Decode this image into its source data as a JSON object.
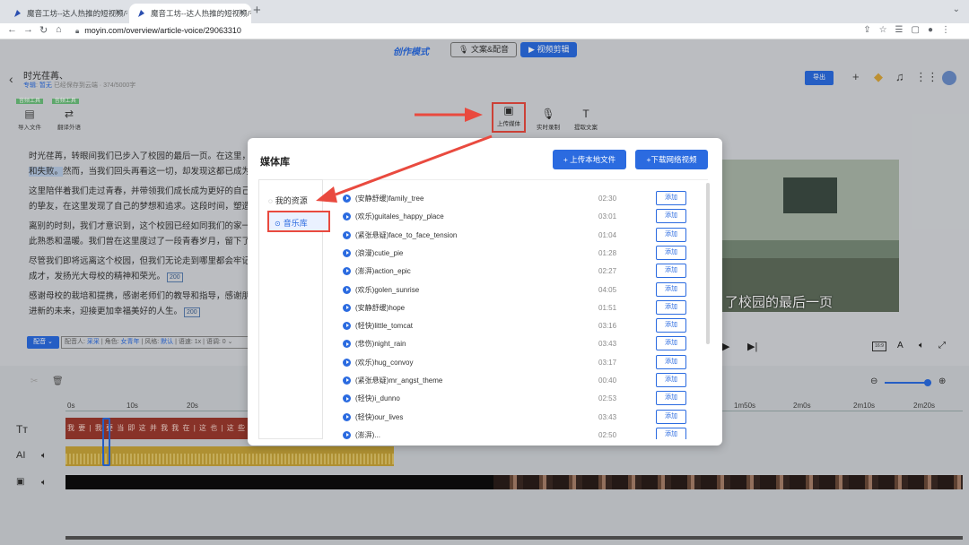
{
  "browser": {
    "tabs": [
      {
        "title": "魔音工坊--达人热推的短视频/有"
      },
      {
        "title": "魔音工坊--达人热推的短视频/有"
      }
    ],
    "url": "moyin.com/overview/article-voice/29063310"
  },
  "app": {
    "mode_label": "创作模式",
    "mode_tabs": [
      {
        "label": "文案&配音"
      },
      {
        "label": "视频剪辑"
      }
    ],
    "doc_title": "时光荏苒、",
    "doc_meta_prefix": "专辑",
    "doc_meta_link": "暂无",
    "doc_meta_rest": "已经保存到云端 · 374/5000字",
    "export_label": "导出"
  },
  "editor": {
    "rule_tags": [
      "音频工具",
      "音频工具"
    ],
    "tools": [
      {
        "label": "导入文件"
      },
      {
        "label": "翻译外语"
      }
    ],
    "right_tools": [
      {
        "label": "上传媒体"
      },
      {
        "label": "实时录制"
      },
      {
        "label": "提取文案"
      }
    ],
    "paragraphs": [
      {
        "line1": "时光荏苒，转眼间我们已步入了校园的最后一页。在这里，我",
        "line2_hl": "和失败。",
        "line2": "然而，当我们回头再看这一切，却发现这都已成为人"
      },
      {
        "line1": "这里陪伴着我们走过青春，并带领我们成长成为更好的自己。",
        "line2": "的挚友，在这里发现了自己的梦想和追求。这段时间，塑造了"
      },
      {
        "line1": "离别的时刻，我们才意识到，这个校园已经如同我们的家一样",
        "line2": "此熟悉和温暖。我们曾在这里度过了一段青春岁月，留下了点"
      },
      {
        "line1": "尽管我们即将远离这个校园，但我们无论走到哪里都会牢记这",
        "line2": "成才，发扬光大母校的精神和荣光。",
        "count": "200"
      },
      {
        "line1": "感谢母校的栽培和提携，感谢老师们的教导和指导，感谢朋友",
        "line2": "进新的未来，迎接更加幸福美好的人生。",
        "count": "200"
      }
    ],
    "voice_btn": "配音",
    "voice_meta_1": "配音人:",
    "voice_meta_link1": "采采",
    "voice_meta_2": "| 角色:",
    "voice_meta_link2": "女青年",
    "voice_meta_3": "| 风格:",
    "voice_meta_link3": "默认",
    "voice_meta_4": "| 语速: 1x | 语调: 0"
  },
  "preview": {
    "subtitle": "了校园的最后一页",
    "ratio": "16:9"
  },
  "timeline": {
    "ruler": [
      "0s",
      "10s",
      "20s",
      "1m50s",
      "2m0s",
      "2m10s",
      "2m20s"
    ],
    "text_clip": "我 要 | 我 要 当 即 这 并 我 我 在 | 这 也 | 这 些 这 天",
    "track_icons": [
      "text-track-icon",
      "ai-voice-track-icon",
      "video-track-icon"
    ]
  },
  "modal": {
    "title": "媒体库",
    "upload_local": "+ 上传本地文件",
    "download_online": "+下载网络视频",
    "side": [
      {
        "label": "我的资源"
      },
      {
        "label": "音乐库"
      }
    ],
    "add_label": "添加",
    "tracks": [
      {
        "name": "(安静舒缓)family_tree",
        "duration": "02:30"
      },
      {
        "name": "(欢乐)guitales_happy_place",
        "duration": "03:01"
      },
      {
        "name": "(紧张悬疑)face_to_face_tension",
        "duration": "01:04"
      },
      {
        "name": "(浪漫)cutie_pie",
        "duration": "01:28"
      },
      {
        "name": "(澎湃)action_epic",
        "duration": "02:27"
      },
      {
        "name": "(欢乐)golen_sunrise",
        "duration": "04:05"
      },
      {
        "name": "(安静舒缓)hope",
        "duration": "01:51"
      },
      {
        "name": "(轻快)little_tomcat",
        "duration": "03:16"
      },
      {
        "name": "(悲伤)night_rain",
        "duration": "03:43"
      },
      {
        "name": "(欢乐)hug_convoy",
        "duration": "03:17"
      },
      {
        "name": "(紧张悬疑)mr_angst_theme",
        "duration": "00:40"
      },
      {
        "name": "(轻快)i_dunno",
        "duration": "02:53"
      },
      {
        "name": "(轻快)our_lives",
        "duration": "03:43"
      },
      {
        "name": "(澎湃)...",
        "duration": "02:50"
      }
    ]
  },
  "colors": {
    "accent": "#2b6be0",
    "annotation": "#e94a3f"
  }
}
